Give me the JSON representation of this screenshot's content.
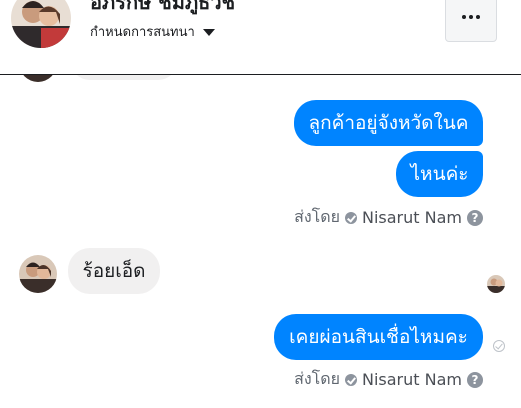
{
  "header": {
    "contact_name": "อภิรักษ์ ชมภูธิวัช",
    "subtitle": "กำหนดการสนทนา",
    "avatar_icon": "profile-photo-couple",
    "more_icon": "more-horizontal-icon"
  },
  "messages": [
    {
      "direction": "incoming",
      "text": ""
    },
    {
      "direction": "outgoing",
      "text": "ลูกค้าอยู่จังหวัดในค"
    },
    {
      "direction": "outgoing",
      "text": "ไหนค่ะ"
    },
    {
      "direction": "incoming",
      "text": "ร้อยเอ็ด"
    },
    {
      "direction": "outgoing",
      "text": "เคยผ่อนสินเชื่อไหมคะ"
    }
  ],
  "status": [
    {
      "prefix": "ส่งโดย",
      "name": "Nisarut Nam",
      "help": "?"
    },
    {
      "prefix": "ส่งโดย",
      "name": "Nisarut Nam",
      "help": "?"
    }
  ],
  "colors": {
    "outgoing_bubble": "#0084ff",
    "incoming_bubble": "#f1f0f0",
    "meta_text": "#606770"
  }
}
